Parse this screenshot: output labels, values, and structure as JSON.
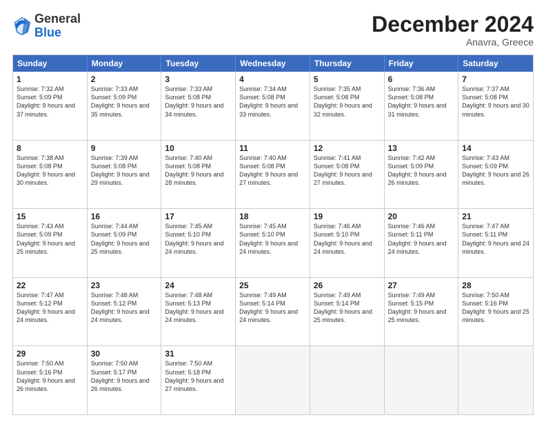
{
  "logo": {
    "general": "General",
    "blue": "Blue"
  },
  "header": {
    "month": "December 2024",
    "location": "Anavra, Greece"
  },
  "weekdays": [
    "Sunday",
    "Monday",
    "Tuesday",
    "Wednesday",
    "Thursday",
    "Friday",
    "Saturday"
  ],
  "weeks": [
    [
      {
        "day": "1",
        "sunrise": "Sunrise: 7:32 AM",
        "sunset": "Sunset: 5:09 PM",
        "daylight": "Daylight: 9 hours and 37 minutes."
      },
      {
        "day": "2",
        "sunrise": "Sunrise: 7:33 AM",
        "sunset": "Sunset: 5:09 PM",
        "daylight": "Daylight: 9 hours and 35 minutes."
      },
      {
        "day": "3",
        "sunrise": "Sunrise: 7:33 AM",
        "sunset": "Sunset: 5:08 PM",
        "daylight": "Daylight: 9 hours and 34 minutes."
      },
      {
        "day": "4",
        "sunrise": "Sunrise: 7:34 AM",
        "sunset": "Sunset: 5:08 PM",
        "daylight": "Daylight: 9 hours and 33 minutes."
      },
      {
        "day": "5",
        "sunrise": "Sunrise: 7:35 AM",
        "sunset": "Sunset: 5:08 PM",
        "daylight": "Daylight: 9 hours and 32 minutes."
      },
      {
        "day": "6",
        "sunrise": "Sunrise: 7:36 AM",
        "sunset": "Sunset: 5:08 PM",
        "daylight": "Daylight: 9 hours and 31 minutes."
      },
      {
        "day": "7",
        "sunrise": "Sunrise: 7:37 AM",
        "sunset": "Sunset: 5:08 PM",
        "daylight": "Daylight: 9 hours and 30 minutes."
      }
    ],
    [
      {
        "day": "8",
        "sunrise": "Sunrise: 7:38 AM",
        "sunset": "Sunset: 5:08 PM",
        "daylight": "Daylight: 9 hours and 30 minutes."
      },
      {
        "day": "9",
        "sunrise": "Sunrise: 7:39 AM",
        "sunset": "Sunset: 5:08 PM",
        "daylight": "Daylight: 9 hours and 29 minutes."
      },
      {
        "day": "10",
        "sunrise": "Sunrise: 7:40 AM",
        "sunset": "Sunset: 5:08 PM",
        "daylight": "Daylight: 9 hours and 28 minutes."
      },
      {
        "day": "11",
        "sunrise": "Sunrise: 7:40 AM",
        "sunset": "Sunset: 5:08 PM",
        "daylight": "Daylight: 9 hours and 27 minutes."
      },
      {
        "day": "12",
        "sunrise": "Sunrise: 7:41 AM",
        "sunset": "Sunset: 5:08 PM",
        "daylight": "Daylight: 9 hours and 27 minutes."
      },
      {
        "day": "13",
        "sunrise": "Sunrise: 7:42 AM",
        "sunset": "Sunset: 5:09 PM",
        "daylight": "Daylight: 9 hours and 26 minutes."
      },
      {
        "day": "14",
        "sunrise": "Sunrise: 7:43 AM",
        "sunset": "Sunset: 5:09 PM",
        "daylight": "Daylight: 9 hours and 26 minutes."
      }
    ],
    [
      {
        "day": "15",
        "sunrise": "Sunrise: 7:43 AM",
        "sunset": "Sunset: 5:09 PM",
        "daylight": "Daylight: 9 hours and 25 minutes."
      },
      {
        "day": "16",
        "sunrise": "Sunrise: 7:44 AM",
        "sunset": "Sunset: 5:09 PM",
        "daylight": "Daylight: 9 hours and 25 minutes."
      },
      {
        "day": "17",
        "sunrise": "Sunrise: 7:45 AM",
        "sunset": "Sunset: 5:10 PM",
        "daylight": "Daylight: 9 hours and 24 minutes."
      },
      {
        "day": "18",
        "sunrise": "Sunrise: 7:45 AM",
        "sunset": "Sunset: 5:10 PM",
        "daylight": "Daylight: 9 hours and 24 minutes."
      },
      {
        "day": "19",
        "sunrise": "Sunrise: 7:46 AM",
        "sunset": "Sunset: 5:10 PM",
        "daylight": "Daylight: 9 hours and 24 minutes."
      },
      {
        "day": "20",
        "sunrise": "Sunrise: 7:46 AM",
        "sunset": "Sunset: 5:11 PM",
        "daylight": "Daylight: 9 hours and 24 minutes."
      },
      {
        "day": "21",
        "sunrise": "Sunrise: 7:47 AM",
        "sunset": "Sunset: 5:11 PM",
        "daylight": "Daylight: 9 hours and 24 minutes."
      }
    ],
    [
      {
        "day": "22",
        "sunrise": "Sunrise: 7:47 AM",
        "sunset": "Sunset: 5:12 PM",
        "daylight": "Daylight: 9 hours and 24 minutes."
      },
      {
        "day": "23",
        "sunrise": "Sunrise: 7:48 AM",
        "sunset": "Sunset: 5:12 PM",
        "daylight": "Daylight: 9 hours and 24 minutes."
      },
      {
        "day": "24",
        "sunrise": "Sunrise: 7:48 AM",
        "sunset": "Sunset: 5:13 PM",
        "daylight": "Daylight: 9 hours and 24 minutes."
      },
      {
        "day": "25",
        "sunrise": "Sunrise: 7:49 AM",
        "sunset": "Sunset: 5:14 PM",
        "daylight": "Daylight: 9 hours and 24 minutes."
      },
      {
        "day": "26",
        "sunrise": "Sunrise: 7:49 AM",
        "sunset": "Sunset: 5:14 PM",
        "daylight": "Daylight: 9 hours and 25 minutes."
      },
      {
        "day": "27",
        "sunrise": "Sunrise: 7:49 AM",
        "sunset": "Sunset: 5:15 PM",
        "daylight": "Daylight: 9 hours and 25 minutes."
      },
      {
        "day": "28",
        "sunrise": "Sunrise: 7:50 AM",
        "sunset": "Sunset: 5:16 PM",
        "daylight": "Daylight: 9 hours and 25 minutes."
      }
    ],
    [
      {
        "day": "29",
        "sunrise": "Sunrise: 7:50 AM",
        "sunset": "Sunset: 5:16 PM",
        "daylight": "Daylight: 9 hours and 26 minutes."
      },
      {
        "day": "30",
        "sunrise": "Sunrise: 7:50 AM",
        "sunset": "Sunset: 5:17 PM",
        "daylight": "Daylight: 9 hours and 26 minutes."
      },
      {
        "day": "31",
        "sunrise": "Sunrise: 7:50 AM",
        "sunset": "Sunset: 5:18 PM",
        "daylight": "Daylight: 9 hours and 27 minutes."
      },
      null,
      null,
      null,
      null
    ]
  ]
}
